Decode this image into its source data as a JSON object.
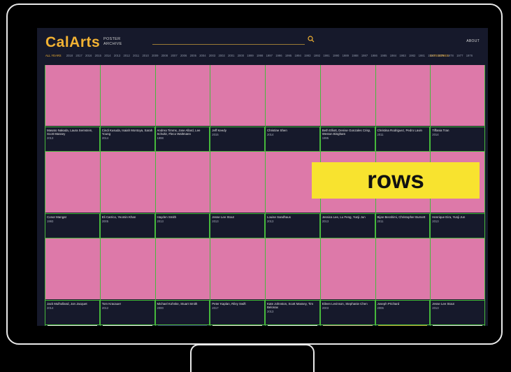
{
  "header": {
    "logo": "CalArts",
    "logo_sub_line1": "POSTER",
    "logo_sub_line2": "ARCHIVE",
    "about": "ABOUT",
    "all_years": "ALL YEARS",
    "years": [
      "2018",
      "2017",
      "2016",
      "2015",
      "2014",
      "2013",
      "2012",
      "2011",
      "2010",
      "2009",
      "2008",
      "2007",
      "2006",
      "2005",
      "2004",
      "2003",
      "2002",
      "2001",
      "2000",
      "1999",
      "1998",
      "1997",
      "1996",
      "1995",
      "1994",
      "1993",
      "1992",
      "1991",
      "1990",
      "1989",
      "1988",
      "1987",
      "1986",
      "1985",
      "1984",
      "1983",
      "1982",
      "1981",
      "1980",
      "1979",
      "1978",
      "1977",
      "1976"
    ],
    "categories": "CATEGORIES"
  },
  "annotation": "rows",
  "row1": [
    {
      "title": "Masato Nakada, Laura Sernstein, Scott Massey",
      "year": "2013"
    },
    {
      "title": "Cindi Kusuda, Isaiah Montoya, Sarah Young",
      "year": "2014"
    },
    {
      "title": "Andrea Timms, Jose Allard, Lee Schultz, Fleco Waltmann",
      "year": "1998"
    },
    {
      "title": "Jeff Keedy",
      "year": "2015"
    },
    {
      "title": "Christine Shen",
      "year": "2014"
    },
    {
      "title": "Beth Elliott, Denise Gonzales Crisp, Weston Bingham",
      "year": "1995"
    },
    {
      "title": "Christina Rodriguez, Pedro Lavin",
      "year": "2011"
    },
    {
      "title": "Tiffania Tran",
      "year": "2014"
    }
  ],
  "row2": [
    {
      "title": "Conor Mangat",
      "year": "1993"
    },
    {
      "title": "Eli Carrico, Yeomin Khan",
      "year": "2005"
    },
    {
      "title": "Hayden Smith",
      "year": "2013"
    },
    {
      "title": "Jesse Lee Stout",
      "year": "2013"
    },
    {
      "title": "Louise Sandhaus",
      "year": "2013"
    },
    {
      "title": "Jessica Lee, Lu Feng, Yunji Jun",
      "year": "2013"
    },
    {
      "title": "Bijan Berahimi, Christopher Burnett",
      "year": "2011"
    },
    {
      "title": "Henrique Eira, Yunji Jun",
      "year": "2013"
    }
  ],
  "row3": [
    {
      "title": "Jack Mulholland, Jon Jacquet",
      "year": "2014"
    },
    {
      "title": "Tom Kracauer",
      "year": "2012"
    },
    {
      "title": "Michael Kohnke, Stuart Smith",
      "year": "2000"
    },
    {
      "title": "Peter Kaplan, Riley Swift",
      "year": "2017"
    },
    {
      "title": "Kate Johnston, Scott Massey, Tim Belonax",
      "year": "2013"
    },
    {
      "title": "Eileen Levinson, Stephanie Chen",
      "year": "2003"
    },
    {
      "title": "Joseph Prichard",
      "year": "2006"
    },
    {
      "title": "Jesse Lee Stout",
      "year": "2013"
    }
  ]
}
